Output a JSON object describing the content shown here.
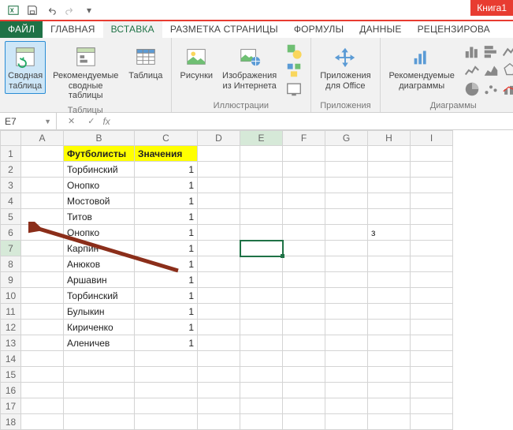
{
  "title": "Книга1",
  "tabs": {
    "file": "ФАЙЛ",
    "home": "ГЛАВНАЯ",
    "insert": "ВСТАВКА",
    "pagelayout": "РАЗМЕТКА СТРАНИЦЫ",
    "formulas": "ФОРМУЛЫ",
    "data": "ДАННЫЕ",
    "review": "РЕЦЕНЗИРОВА"
  },
  "ribbon": {
    "pivot": "Сводная\nтаблица",
    "recpivot": "Рекомендуемые\nсводные таблицы",
    "table": "Таблица",
    "tables_group": "Таблицы",
    "pictures": "Рисунки",
    "onlinepics": "Изображения\nиз Интернета",
    "illus_group": "Иллюстрации",
    "apps": "Приложения\nдля Office",
    "apps_group": "Приложения",
    "reccharts": "Рекомендуемые\nдиаграммы",
    "charts_group": "Диаграммы"
  },
  "namebox": "E7",
  "fx_label": "fx",
  "columns": [
    "A",
    "B",
    "C",
    "D",
    "E",
    "F",
    "G",
    "H",
    "I"
  ],
  "headers": {
    "players": "Футболисты",
    "values": "Значения"
  },
  "rows": [
    {
      "n": 2,
      "b": "Торбинский",
      "c": 1
    },
    {
      "n": 3,
      "b": "Онопко",
      "c": 1
    },
    {
      "n": 4,
      "b": "Мостовой",
      "c": 1
    },
    {
      "n": 5,
      "b": "Титов",
      "c": 1
    },
    {
      "n": 6,
      "b": "Онопко",
      "c": 1
    },
    {
      "n": 7,
      "b": "Карпин",
      "c": 1
    },
    {
      "n": 8,
      "b": "Анюков",
      "c": 1
    },
    {
      "n": 9,
      "b": "Аршавин",
      "c": 1
    },
    {
      "n": 10,
      "b": "Торбинский",
      "c": 1
    },
    {
      "n": 11,
      "b": "Булыкин",
      "c": 1
    },
    {
      "n": 12,
      "b": "Кириченко",
      "c": 1
    },
    {
      "n": 13,
      "b": "Аленичев",
      "c": 1
    }
  ],
  "stray": {
    "row": 6,
    "col": "H",
    "val": "з"
  },
  "active_cell": "E7",
  "col_widths": {
    "A": 54,
    "B": 90,
    "C": 80,
    "D": 54,
    "E": 54,
    "F": 54,
    "G": 54,
    "H": 54,
    "I": 54
  }
}
